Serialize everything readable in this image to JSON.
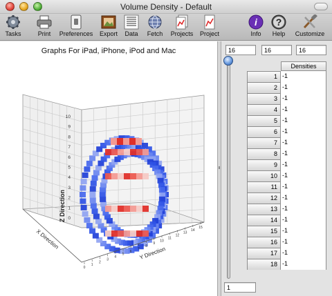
{
  "window": {
    "title": "Volume Density - Default"
  },
  "toolbar": {
    "items": [
      {
        "label": "Tasks",
        "icon": "gear-icon"
      },
      {
        "label": "Print",
        "icon": "printer-icon"
      },
      {
        "label": "Preferences",
        "icon": "switch-icon"
      },
      {
        "label": "Export",
        "icon": "picture-frame-icon"
      },
      {
        "label": "Data",
        "icon": "numbers-table-icon"
      },
      {
        "label": "Fetch",
        "icon": "globe-icon"
      },
      {
        "label": "Projects",
        "icon": "documents-chart-icon"
      },
      {
        "label": "Project",
        "icon": "document-chart-icon"
      },
      {
        "label": "Info",
        "icon": "info-icon"
      },
      {
        "label": "Help",
        "icon": "help-icon"
      },
      {
        "label": "Customize",
        "icon": "tools-icon"
      }
    ]
  },
  "graph": {
    "title": "Graphs For iPad, iPhone, iPod and Mac",
    "z_label": "Z Direction",
    "y_label": "Y Direction",
    "x_label": "X Direction",
    "z_ticks": [
      "0",
      "1",
      "2",
      "3",
      "4",
      "5",
      "6",
      "7",
      "8",
      "9",
      "10"
    ],
    "y_ticks": [
      "0",
      "1",
      "2",
      "3",
      "4",
      "5",
      "6",
      "7",
      "8",
      "9",
      "10",
      "11",
      "12",
      "13",
      "14",
      "15"
    ]
  },
  "controls": {
    "dim_x": "16",
    "dim_y": "16",
    "dim_z": "16",
    "slider_value": "1",
    "column_header": "Densities"
  },
  "table": {
    "rows": [
      {
        "index": "1",
        "value": "-1"
      },
      {
        "index": "2",
        "value": "-1"
      },
      {
        "index": "3",
        "value": "-1"
      },
      {
        "index": "4",
        "value": "-1"
      },
      {
        "index": "5",
        "value": "-1"
      },
      {
        "index": "6",
        "value": "-1"
      },
      {
        "index": "7",
        "value": "-1"
      },
      {
        "index": "8",
        "value": "-1"
      },
      {
        "index": "9",
        "value": "-1"
      },
      {
        "index": "10",
        "value": "-1"
      },
      {
        "index": "11",
        "value": "-1"
      },
      {
        "index": "12",
        "value": "-1"
      },
      {
        "index": "13",
        "value": "-1"
      },
      {
        "index": "14",
        "value": "-1"
      },
      {
        "index": "15",
        "value": "-1"
      },
      {
        "index": "16",
        "value": "-1"
      },
      {
        "index": "17",
        "value": "-1"
      },
      {
        "index": "18",
        "value": "-1"
      }
    ]
  },
  "colors": {
    "accent_blue": "#1f3fd8",
    "accent_red": "#e0302a",
    "info_purple": "#6a2fb5"
  }
}
